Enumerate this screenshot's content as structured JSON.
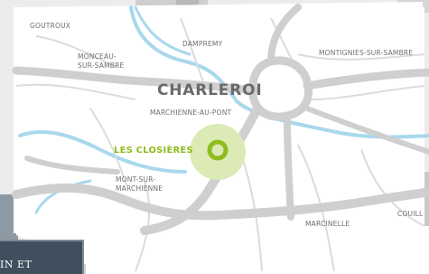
{
  "map": {
    "city": "CHARLEROI",
    "highlight": {
      "name": "LES CLOSIÈRES",
      "color": "#8fbc1e"
    },
    "places": {
      "goutroux": "GOUTROUX",
      "monceau_line1": "MONCEAU-",
      "monceau_line2": "SUR-SAMBRE",
      "dampremy": "DAMPREMY",
      "montignies": "MONTIGNIES-SUR-SAMBRE",
      "marchienne_au_pont": "MARCHIENNE-AU-PONT",
      "mont_line1": "MONT-SUR-",
      "mont_line2": "MARCHIENNE",
      "marcinelle": "MARCINELLE",
      "couillet": "COUILL"
    },
    "colors": {
      "road": "#cfcfcf",
      "road_minor": "#d9d9d9",
      "river": "#9fd4ea",
      "marker_halo": "#dcebb5"
    }
  },
  "caption": {
    "text": "IN ET"
  }
}
